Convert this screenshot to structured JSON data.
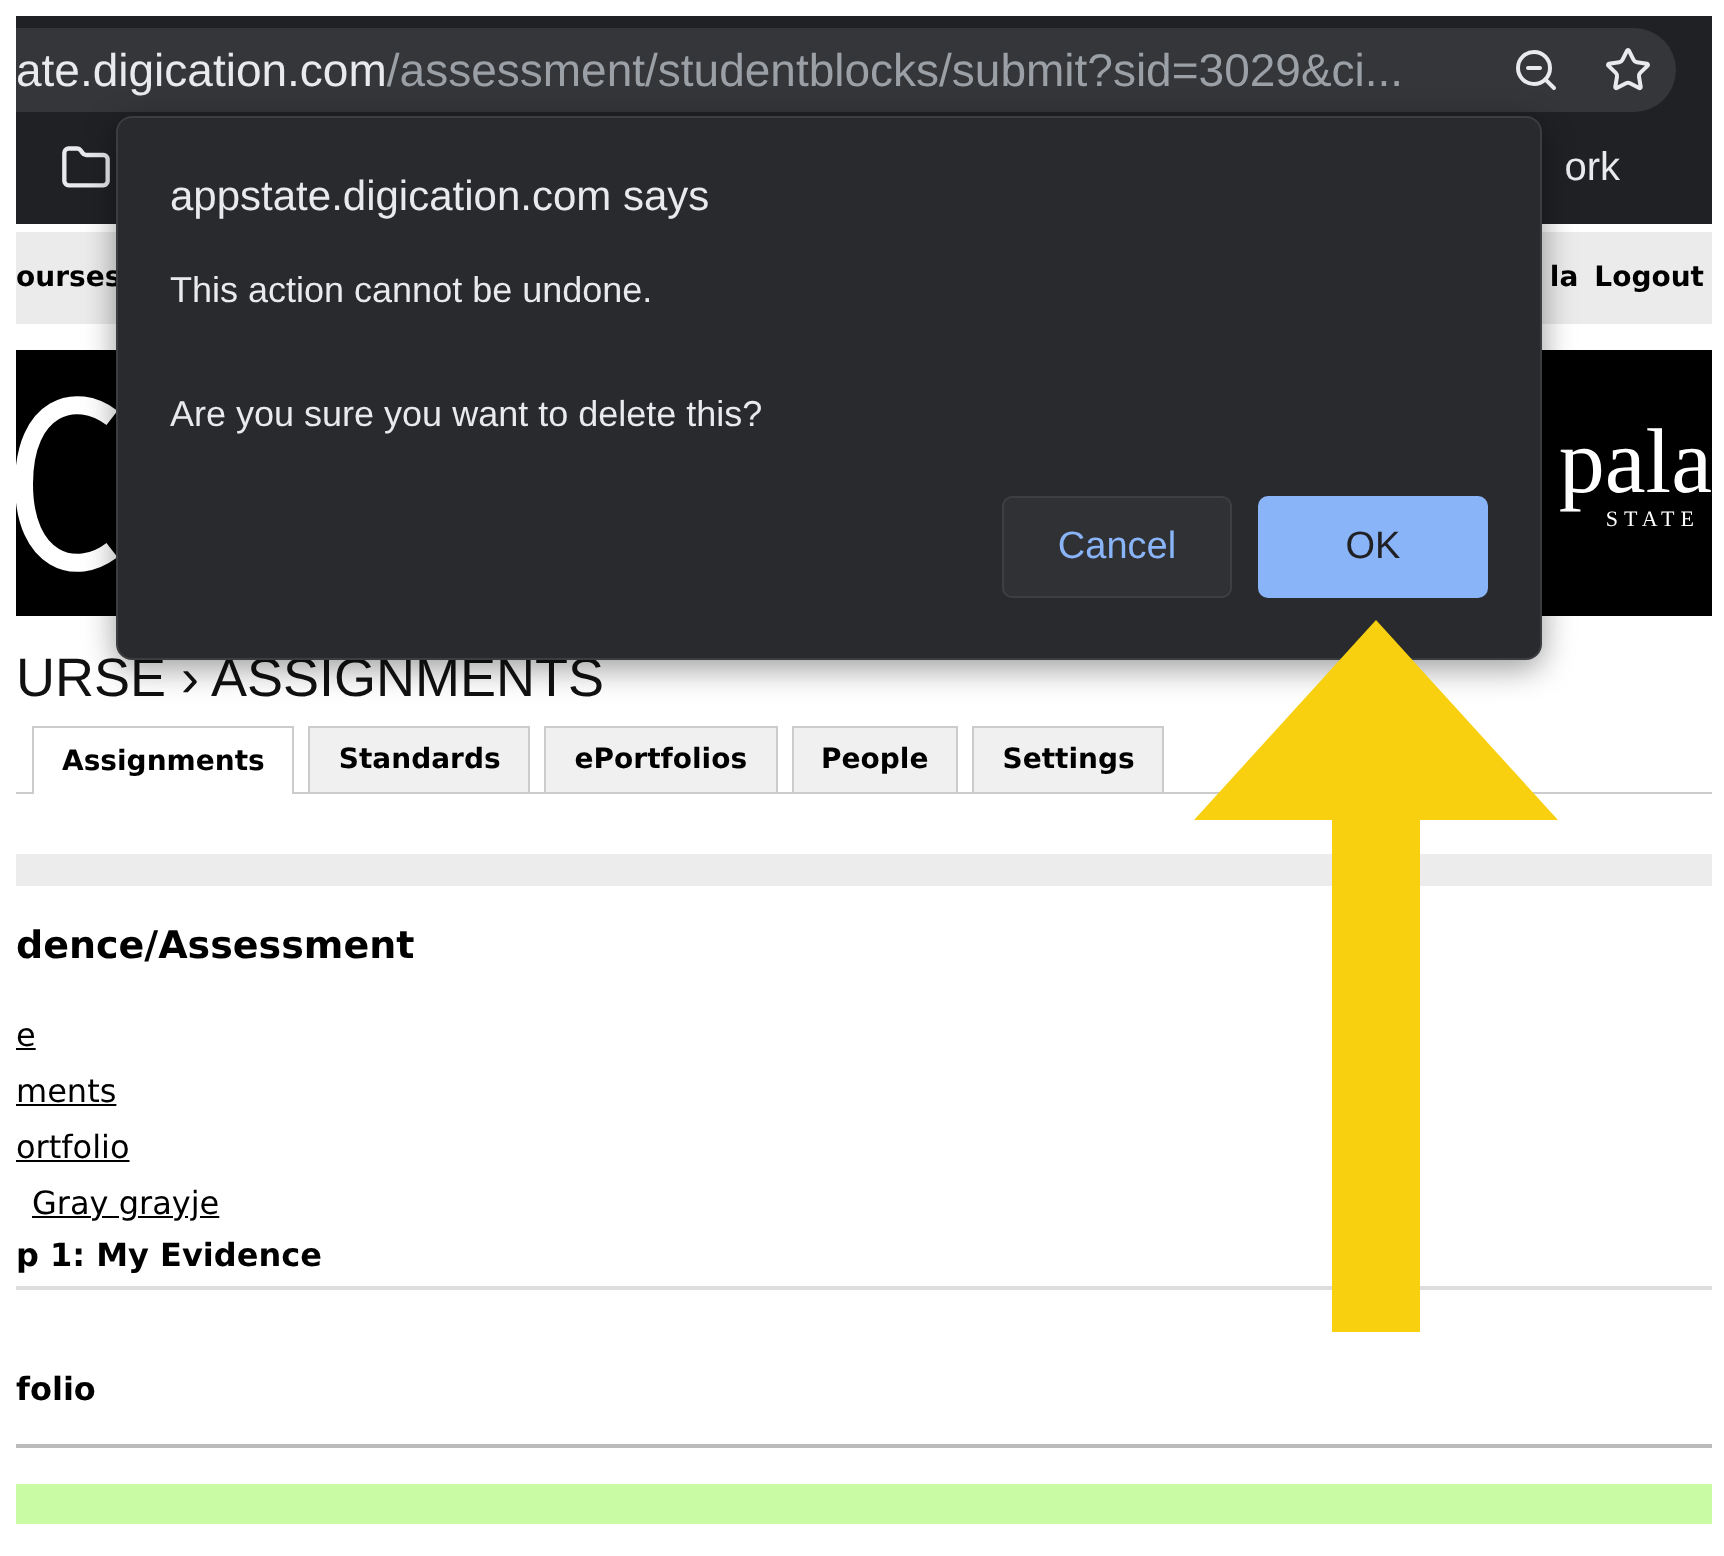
{
  "browser": {
    "url_host": "ate.digication.com",
    "url_path": "/assessment/studentblocks/submit?sid=3029&ci...",
    "bookmark": "ork"
  },
  "nav": {
    "left": "ourses",
    "user": "la",
    "logout": "Logout"
  },
  "banner": {
    "right_name": "pala",
    "right_sub": "STATE"
  },
  "breadcrumb": "URSE › ASSIGNMENTS",
  "tabs": [
    {
      "label": "Assignments",
      "selected": true
    },
    {
      "label": "Standards",
      "selected": false
    },
    {
      "label": "ePortfolios",
      "selected": false
    },
    {
      "label": "People",
      "selected": false
    },
    {
      "label": "Settings",
      "selected": false
    }
  ],
  "section_title": "dence/Assessment",
  "links": [
    "e",
    "ments",
    "ortfolio",
    "Gray grayje"
  ],
  "block_title": "p 1: My Evidence",
  "portfolio_title": "folio",
  "dialog": {
    "title": "appstate.digication.com says",
    "lines": [
      "This action cannot be undone.",
      "Are you sure you want to delete this?"
    ],
    "buttons": [
      {
        "label": "Cancel",
        "kind": "secondary"
      },
      {
        "label": "OK",
        "kind": "primary"
      }
    ]
  }
}
